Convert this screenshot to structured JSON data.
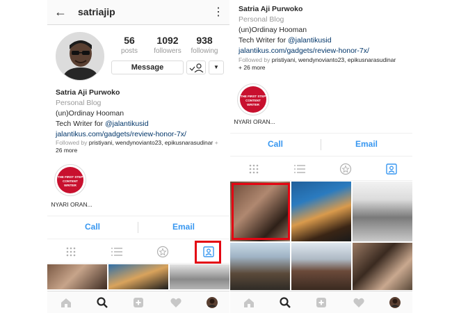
{
  "profile": {
    "username": "satriajip",
    "posts": "56",
    "posts_label": "posts",
    "followers": "1092",
    "followers_label": "followers",
    "following": "938",
    "following_label": "following",
    "message_label": "Message",
    "name": "Satria Aji Purwoko",
    "category": "Personal Blog",
    "bio_line1": "(un)Ordinay Hooman",
    "bio_line2_prefix": "Tech Writer for ",
    "bio_mention": "@jalantikusid",
    "bio_link": "jalantikus.com/gadgets/review-honor-7x/",
    "followed_prefix": "Followed by",
    "followed_names": "pristiyani, wendynovianto23, epikusnarasudinar",
    "followed_suffix_left": "+",
    "followed_more": "26 more",
    "followed_more_right": "+ 26 more"
  },
  "highlight": {
    "label": "NYARI ORAN...",
    "art_line1": "THE FIRST STEP",
    "art_line2": "CONTENT",
    "art_line3": "WRITER"
  },
  "actions": {
    "call": "Call",
    "email": "Email"
  },
  "tabs": [
    "grid-icon",
    "list-icon",
    "saved-icon",
    "tagged-icon"
  ],
  "colors": {
    "link": "#003569",
    "action_blue": "#3897f0",
    "active_tab": "#3897f0",
    "highlight_box": "#e30613",
    "story_red": "#c8102e"
  },
  "bottom_nav": [
    "home-icon",
    "search-icon",
    "add-post-icon",
    "activity-heart-icon",
    "profile-avatar-icon"
  ]
}
